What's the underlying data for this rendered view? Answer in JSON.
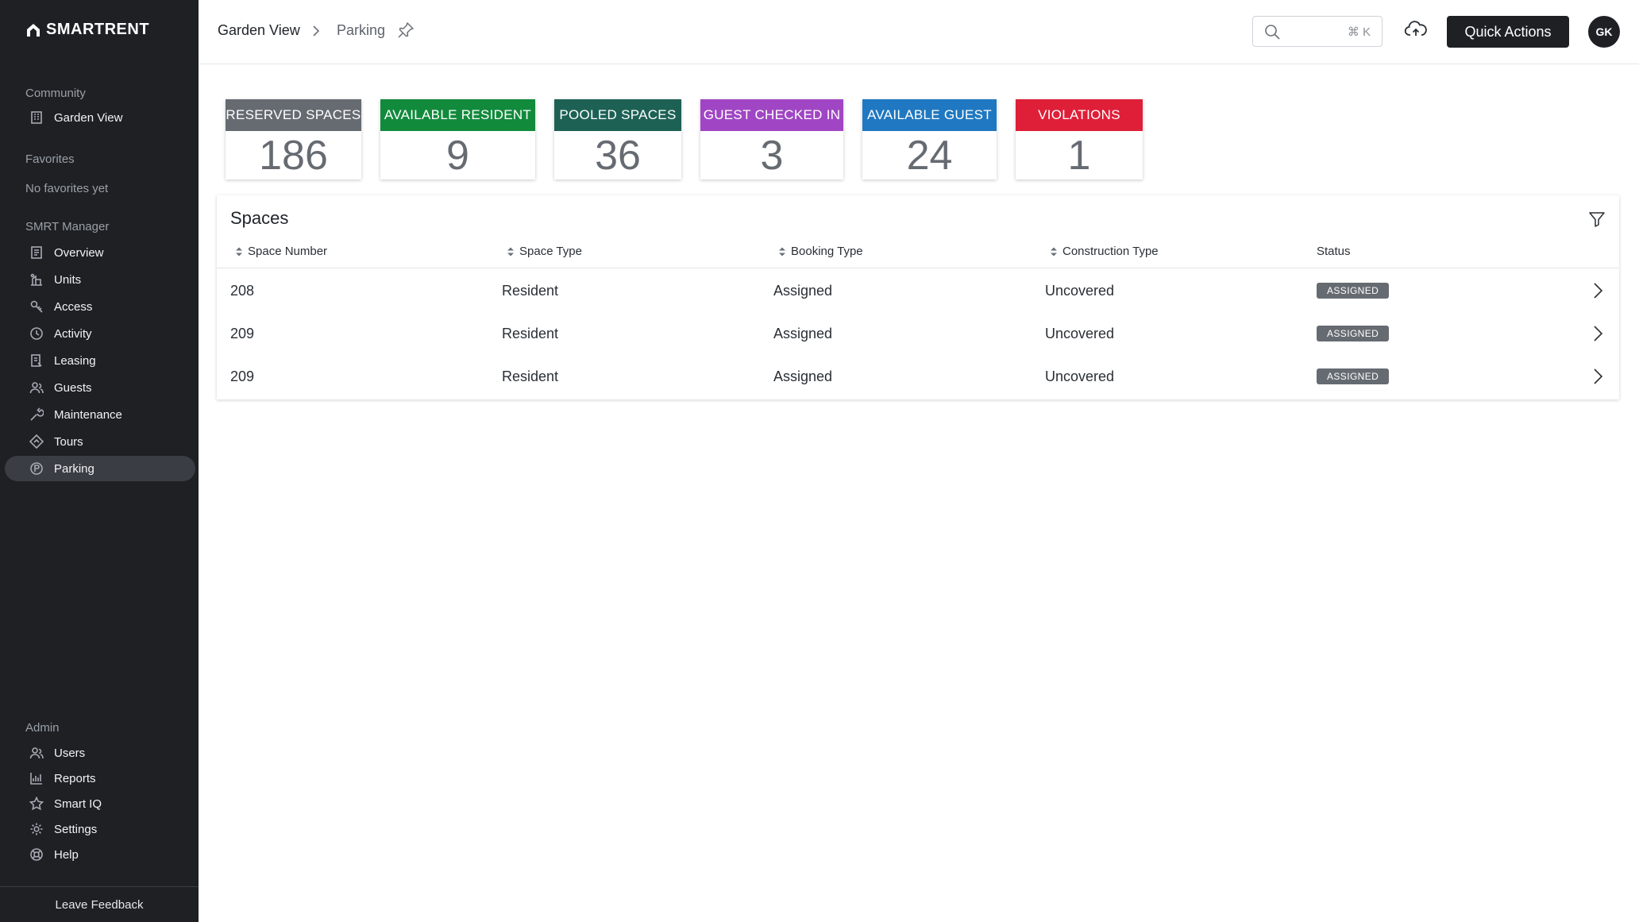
{
  "brand": {
    "logo_text": "SMARTRENT"
  },
  "sidebar": {
    "community_label": "Community",
    "community_item": "Garden View",
    "favorites_label": "Favorites",
    "favorites_empty": "No favorites yet",
    "manager_label": "SMRT Manager",
    "manager_items": [
      {
        "label": "Overview",
        "icon": "overview-icon"
      },
      {
        "label": "Units",
        "icon": "units-icon"
      },
      {
        "label": "Access",
        "icon": "key-icon"
      },
      {
        "label": "Activity",
        "icon": "clock-icon"
      },
      {
        "label": "Leasing",
        "icon": "leasing-icon"
      },
      {
        "label": "Guests",
        "icon": "guests-icon"
      },
      {
        "label": "Maintenance",
        "icon": "wrench-icon"
      },
      {
        "label": "Tours",
        "icon": "tours-icon"
      },
      {
        "label": "Parking",
        "icon": "parking-icon",
        "active": true
      }
    ],
    "admin_label": "Admin",
    "admin_items": [
      {
        "label": "Users",
        "icon": "users-icon"
      },
      {
        "label": "Reports",
        "icon": "reports-icon"
      },
      {
        "label": "Smart IQ",
        "icon": "star-icon"
      },
      {
        "label": "Settings",
        "icon": "gear-icon"
      },
      {
        "label": "Help",
        "icon": "help-icon"
      }
    ],
    "feedback": "Leave Feedback"
  },
  "header": {
    "breadcrumb_root": "Garden View",
    "breadcrumb_current": "Parking",
    "search_shortcut": "⌘ K",
    "quick_actions": "Quick Actions",
    "avatar_initials": "GK"
  },
  "stats": [
    {
      "label": "RESERVED SPACES",
      "value": "186",
      "color": "#666b72"
    },
    {
      "label": "AVAILABLE RESIDENT",
      "value": "9",
      "color": "#128a3c"
    },
    {
      "label": "POOLED SPACES",
      "value": "36",
      "color": "#1d6155"
    },
    {
      "label": "GUEST CHECKED IN",
      "value": "3",
      "color": "#a046c4"
    },
    {
      "label": "AVAILABLE GUEST",
      "value": "24",
      "color": "#1f78c1"
    },
    {
      "label": "VIOLATIONS",
      "value": "1",
      "color": "#df1f38"
    }
  ],
  "spaces": {
    "title": "Spaces",
    "columns": [
      "Space Number",
      "Space Type",
      "Booking Type",
      "Construction Type",
      "Status"
    ],
    "rows": [
      {
        "space_number": "208",
        "space_type": "Resident",
        "booking_type": "Assigned",
        "construction_type": "Uncovered",
        "status": "ASSIGNED"
      },
      {
        "space_number": "209",
        "space_type": "Resident",
        "booking_type": "Assigned",
        "construction_type": "Uncovered",
        "status": "ASSIGNED"
      },
      {
        "space_number": "209",
        "space_type": "Resident",
        "booking_type": "Assigned",
        "construction_type": "Uncovered",
        "status": "ASSIGNED"
      }
    ]
  }
}
